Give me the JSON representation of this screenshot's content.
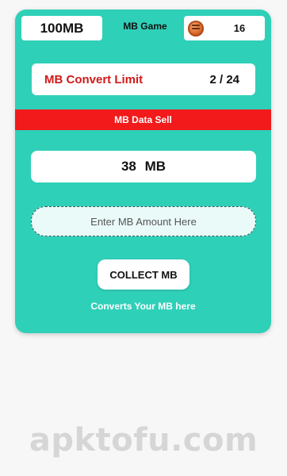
{
  "header": {
    "balance_label": "100MB",
    "game_label": "MB Game",
    "coins_icon": "coin-icon",
    "coins_value": "16"
  },
  "limit": {
    "label": "MB Convert Limit",
    "value": "2 / 24"
  },
  "banner": {
    "label": "MB Data Sell"
  },
  "amount": {
    "value": "38  MB"
  },
  "input": {
    "placeholder": "Enter MB Amount Here",
    "value": ""
  },
  "action": {
    "collect_label": "COLLECT MB",
    "note": "Converts Your MB here"
  },
  "watermark": {
    "text": "apktofu.com"
  },
  "colors": {
    "card_bg": "#2fd0b8",
    "banner_red": "#f21a1a",
    "limit_label_red": "#d11a1a"
  }
}
